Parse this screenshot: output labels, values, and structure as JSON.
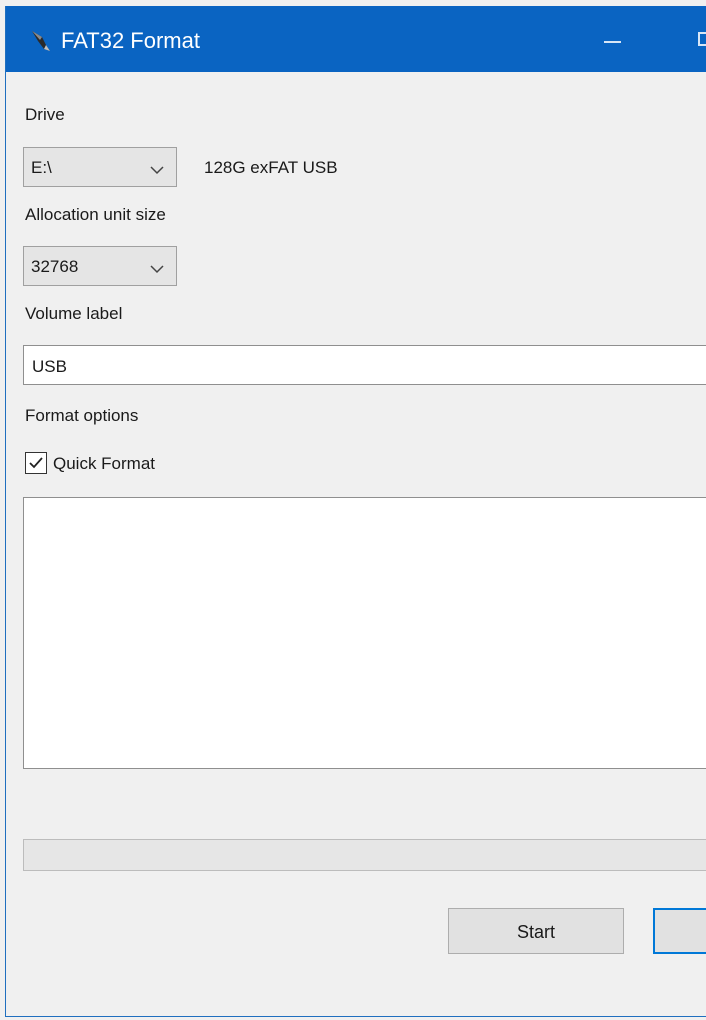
{
  "window": {
    "title": "FAT32 Format",
    "app_icon": "fat32-format-app-icon"
  },
  "titlebar_controls": {
    "minimize_icon": "minimize-icon",
    "maximize_icon": "maximize-icon"
  },
  "drive": {
    "label": "Drive",
    "selected": "E:\\",
    "info": "128G exFAT USB",
    "dropdown_icon": "chevron-down-icon"
  },
  "allocation": {
    "label": "Allocation unit size",
    "selected": "32768",
    "dropdown_icon": "chevron-down-icon"
  },
  "volume": {
    "label": "Volume label",
    "value": "USB"
  },
  "format_options": {
    "label": "Format options",
    "quick_format_label": "Quick Format",
    "quick_format_checked": true
  },
  "progress": {
    "percent": 0
  },
  "buttons": {
    "start_label": "Start",
    "close_label": ""
  },
  "colors": {
    "titlebar": "#0a64c2",
    "focus_border": "#0078d7"
  }
}
